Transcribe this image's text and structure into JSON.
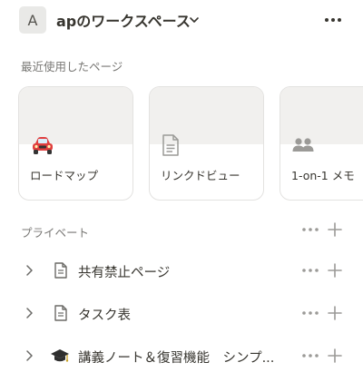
{
  "workspace": {
    "avatar_letter": "A",
    "name": "apのワークスペース",
    "chevron_icon": "chevron-down-icon",
    "more_icon": "more-horizontal-icon"
  },
  "recent": {
    "label": "最近使用したページ",
    "cards": [
      {
        "title": "ロードマップ",
        "icon": "car-emoji-icon"
      },
      {
        "title": "リンクドビュー",
        "icon": "document-icon"
      },
      {
        "title": "1-on-1 メモ",
        "icon": "people-icon"
      }
    ]
  },
  "private": {
    "label": "プライベート",
    "more_icon": "more-horizontal-icon",
    "add_icon": "plus-icon",
    "pages": [
      {
        "title": "共有禁止ページ",
        "icon": "document-icon"
      },
      {
        "title": "タスク表",
        "icon": "document-icon"
      },
      {
        "title": "講義ノート＆復習機能　シンプ...",
        "icon": "graduation-cap-icon"
      }
    ]
  },
  "colors": {
    "text": "#37352f",
    "muted": "#787774",
    "icon_gray": "#9b9a97",
    "card_cover": "#f1f0ee",
    "border": "#e3e2e0",
    "car_red": "#e03e3e"
  }
}
